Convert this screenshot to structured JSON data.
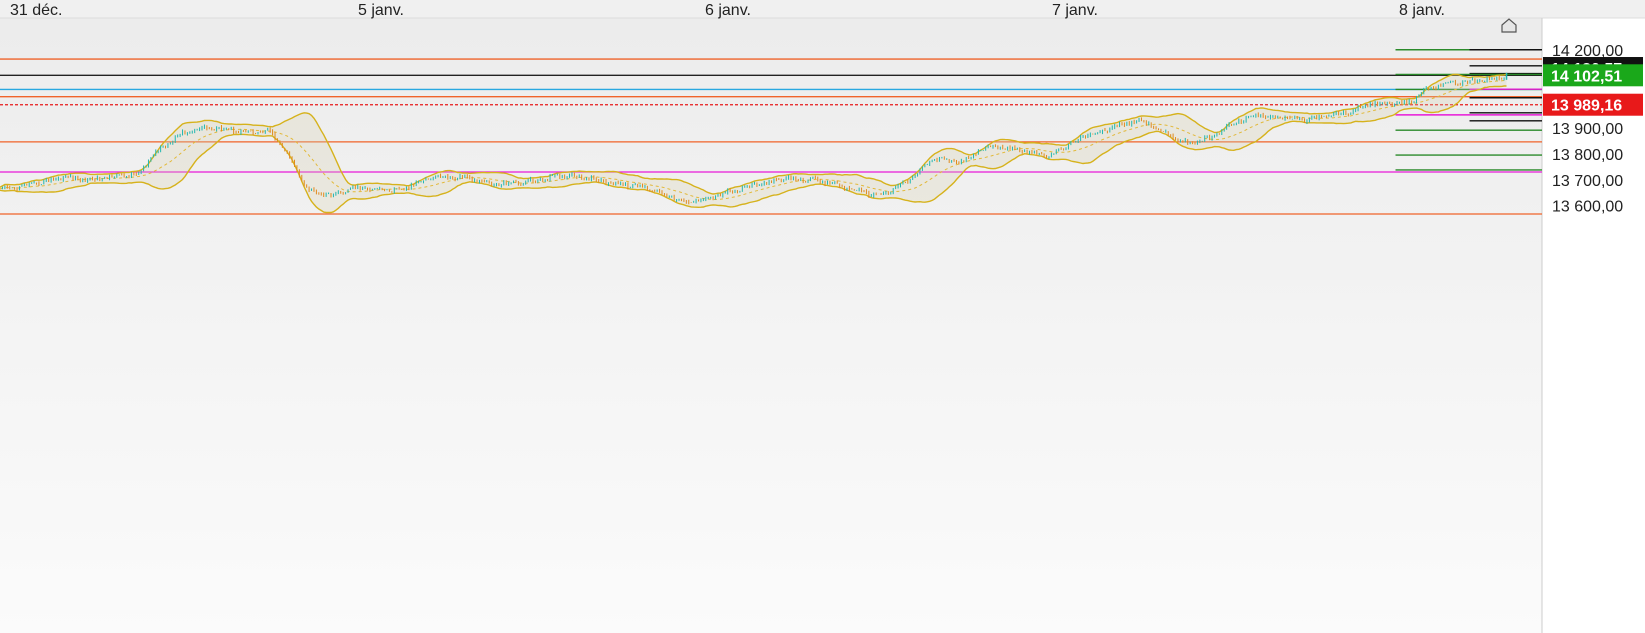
{
  "chart_data": {
    "type": "line",
    "style": "bar-ohlc-with-bollinger-bands",
    "x_ticks": [
      "31 déc.",
      "5 janv.",
      "6 janv.",
      "7 janv.",
      "8 janv."
    ],
    "y_ticks": [
      {
        "value": 14200,
        "label": "14 200,00"
      },
      {
        "value": 14000,
        "label": "14 000,00"
      },
      {
        "value": 13900,
        "label": "13 900,00"
      },
      {
        "value": 13800,
        "label": "13 800,00"
      },
      {
        "value": 13700,
        "label": "13 700,00"
      },
      {
        "value": 13600,
        "label": "13 600,00"
      }
    ],
    "ylim": [
      13570,
      14230
    ],
    "price_tags": [
      {
        "value": 14130.57,
        "label": "14 130,57",
        "color": "#111111"
      },
      {
        "value": 14102.51,
        "label": "14 102,51",
        "color": "#1aa81a"
      },
      {
        "value": 13989.16,
        "label": "13 989,16",
        "color": "#e8191a"
      }
    ],
    "full_width_lines": [
      {
        "value": 14165,
        "color": "#f0632a",
        "style": "solid"
      },
      {
        "value": 14102.51,
        "color": "#222222",
        "style": "solid"
      },
      {
        "value": 14048,
        "color": "#29a8e0",
        "style": "solid"
      },
      {
        "value": 14020,
        "color": "#f0632a",
        "style": "solid"
      },
      {
        "value": 13989.16,
        "color": "#e8191a",
        "style": "dotted"
      },
      {
        "value": 13846,
        "color": "#f0632a",
        "style": "solid"
      },
      {
        "value": 13730,
        "color": "#e81ad8",
        "style": "solid"
      },
      {
        "value": 13568,
        "color": "#f0632a",
        "style": "solid"
      }
    ],
    "right_levels": [
      {
        "value": 14201,
        "color": "#2a8a2a",
        "start": 0.905
      },
      {
        "value": 14201,
        "color": "#111111",
        "start": 0.953
      },
      {
        "value": 14139,
        "color": "#111111",
        "start": 0.953
      },
      {
        "value": 14109,
        "color": "#111111",
        "start": 0.953
      },
      {
        "value": 14106,
        "color": "#2a8a2a",
        "start": 0.905
      },
      {
        "value": 14048,
        "color": "#2a8a2a",
        "start": 0.905
      },
      {
        "value": 14049,
        "color": "#e81ad8",
        "start": 0.953
      },
      {
        "value": 14016,
        "color": "#111111",
        "start": 0.953
      },
      {
        "value": 13958,
        "color": "#111111",
        "start": 0.953
      },
      {
        "value": 13950,
        "color": "#e81ad8",
        "start": 0.905
      },
      {
        "value": 13927,
        "color": "#111111",
        "start": 0.953
      },
      {
        "value": 13891,
        "color": "#2a8a2a",
        "start": 0.905
      },
      {
        "value": 13795,
        "color": "#2a8a2a",
        "start": 0.905
      },
      {
        "value": 13738,
        "color": "#2a8a2a",
        "start": 0.905
      }
    ],
    "close_series": {
      "x": [
        0,
        0.02,
        0.04,
        0.06,
        0.075,
        0.09,
        0.1,
        0.115,
        0.13,
        0.15,
        0.16,
        0.175,
        0.185,
        0.2,
        0.215,
        0.23,
        0.245,
        0.26,
        0.27,
        0.28,
        0.3,
        0.32,
        0.345,
        0.37,
        0.395,
        0.42,
        0.445,
        0.465,
        0.475,
        0.49,
        0.51,
        0.525,
        0.54,
        0.555,
        0.565,
        0.575,
        0.59,
        0.605,
        0.625,
        0.64,
        0.66,
        0.68,
        0.7,
        0.72,
        0.74,
        0.755,
        0.77,
        0.785,
        0.8,
        0.815,
        0.83,
        0.845,
        0.86,
        0.875,
        0.89,
        0.905,
        0.915,
        0.925,
        0.935,
        0.945,
        0.955,
        0.965,
        0.975,
        0.977
      ],
      "y": [
        13660,
        13680,
        13710,
        13700,
        13715,
        13720,
        13800,
        13870,
        13900,
        13895,
        13880,
        13885,
        13810,
        13660,
        13640,
        13670,
        13665,
        13655,
        13690,
        13710,
        13710,
        13680,
        13695,
        13720,
        13690,
        13670,
        13610,
        13640,
        13655,
        13680,
        13705,
        13700,
        13685,
        13660,
        13645,
        13650,
        13700,
        13780,
        13770,
        13830,
        13820,
        13790,
        13860,
        13900,
        13930,
        13880,
        13840,
        13860,
        13920,
        13950,
        13940,
        13930,
        13945,
        13960,
        13995,
        13990,
        14000,
        14050,
        14070,
        14075,
        14080,
        14085,
        14095,
        14102.51
      ]
    }
  }
}
